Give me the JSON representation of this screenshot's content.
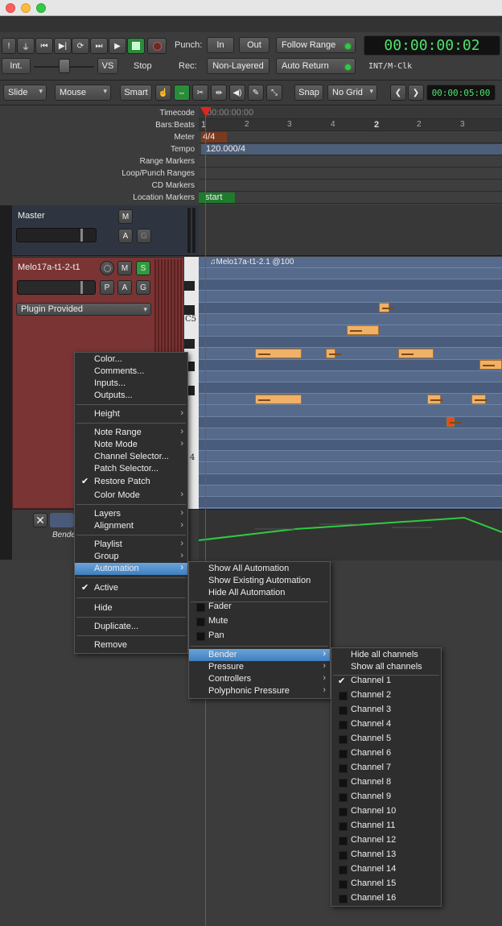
{
  "transport": {
    "punch_label": "Punch:",
    "punch_in": "In",
    "punch_out": "Out",
    "follow_range": "Follow Range",
    "rec_label": "Rec:",
    "non_layered": "Non-Layered",
    "auto_return": "Auto Return",
    "int": "Int.",
    "vs": "VS",
    "stop": "Stop",
    "clock": "00:00:00:02",
    "sync": "INT/M-Clk"
  },
  "toolbar": {
    "edit_mode": "Slide",
    "edit_point": "Mouse",
    "smart": "Smart",
    "snap": "Snap",
    "grid": "No Grid",
    "nudge_clock": "00:00:05:00"
  },
  "rulers": {
    "timecode": "Timecode",
    "bars_beats": "Bars:Beats",
    "meter": "Meter",
    "tempo": "Tempo",
    "range_markers": "Range Markers",
    "loop_punch": "Loop/Punch Ranges",
    "cd_markers": "CD Markers",
    "location_markers": "Location Markers",
    "timecode_value": "00:00:00:00",
    "bar_numbers": [
      "1",
      "2",
      "3",
      "4",
      "2",
      "2",
      "3"
    ],
    "meter_value": "4/4",
    "tempo_value": "120.000/4",
    "location_marker": "start"
  },
  "master": {
    "name": "Master",
    "m": "M",
    "a": "A",
    "g": "G"
  },
  "track": {
    "name": "Melo17a-t1-2-t1",
    "m": "M",
    "s": "S",
    "p": "P",
    "a": "A",
    "g": "G",
    "plugin": "Plugin Provided",
    "region": "♫Melo17a-t1-2.1 @100",
    "c5": "C5",
    "c4": "4",
    "auto_name": "Bende"
  },
  "context_menu": {
    "color": "Color...",
    "comments": "Comments...",
    "inputs": "Inputs...",
    "outputs": "Outputs...",
    "height": "Height",
    "note_range": "Note Range",
    "note_mode": "Note Mode",
    "channel_selector": "Channel Selector...",
    "patch_selector": "Patch Selector...",
    "restore_patch": "Restore Patch",
    "color_mode": "Color Mode",
    "layers": "Layers",
    "alignment": "Alignment",
    "playlist": "Playlist",
    "group": "Group",
    "automation": "Automation",
    "active": "Active",
    "hide": "Hide",
    "duplicate": "Duplicate...",
    "remove": "Remove"
  },
  "automation_menu": {
    "show_all": "Show All Automation",
    "show_existing": "Show Existing Automation",
    "hide_all": "Hide All Automation",
    "fader": "Fader",
    "mute": "Mute",
    "pan": "Pan",
    "bender": "Bender",
    "pressure": "Pressure",
    "controllers": "Controllers",
    "poly_pressure": "Polyphonic Pressure"
  },
  "bender_menu": {
    "hide_all": "Hide all channels",
    "show_all": "Show all channels",
    "channels": [
      "Channel 1",
      "Channel 2",
      "Channel 3",
      "Channel 4",
      "Channel 5",
      "Channel 6",
      "Channel 7",
      "Channel 8",
      "Channel 9",
      "Channel 10",
      "Channel 11",
      "Channel 12",
      "Channel 13",
      "Channel 14",
      "Channel 15",
      "Channel 16"
    ]
  },
  "colors": {
    "accent_green": "#4ee36e",
    "track_red": "#7a3434",
    "lane_blue": "#566a8c",
    "note_orange": "#f0b066",
    "menu_highlight": "#4f8fcf"
  }
}
